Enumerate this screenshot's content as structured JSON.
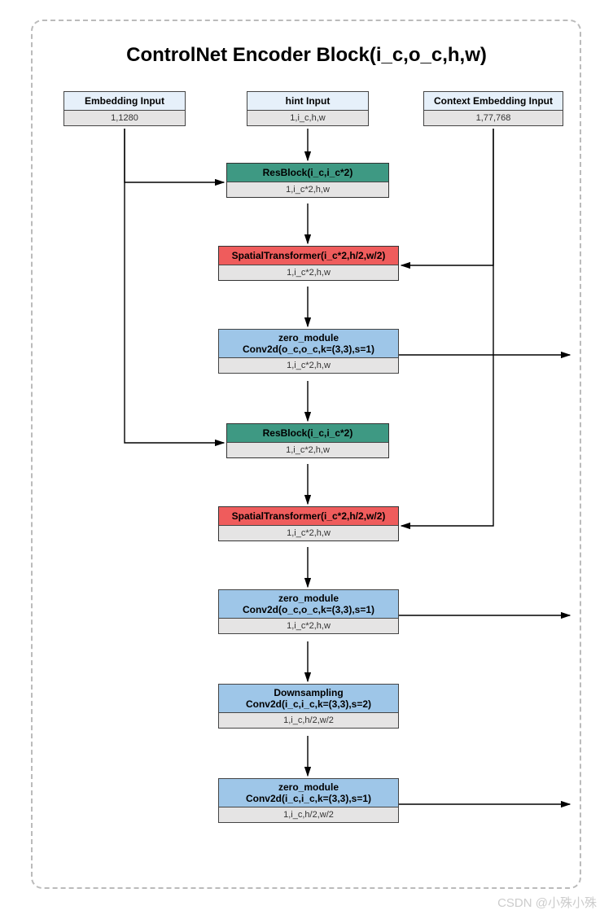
{
  "title": "ControlNet Encoder Block(i_c,o_c,h,w)",
  "inputs": {
    "embedding": {
      "label": "Embedding Input",
      "shape": "1,1280"
    },
    "hint": {
      "label": "hint Input",
      "shape": "1,i_c,h,w"
    },
    "context": {
      "label": "Context Embedding Input",
      "shape": "1,77,768"
    }
  },
  "blocks": [
    {
      "id": "res1",
      "color": "green",
      "title": [
        "ResBlock(i_c,i_c*2)"
      ],
      "shape": "1,i_c*2,h,w"
    },
    {
      "id": "st1",
      "color": "red",
      "title": [
        "SpatialTransformer(i_c*2,h/2,w/2)"
      ],
      "shape": "1,i_c*2,h,w"
    },
    {
      "id": "zero1",
      "color": "blue",
      "title": [
        "zero_module",
        "Conv2d(o_c,o_c,k=(3,3),s=1)"
      ],
      "shape": "1,i_c*2,h,w"
    },
    {
      "id": "res2",
      "color": "green",
      "title": [
        "ResBlock(i_c,i_c*2)"
      ],
      "shape": "1,i_c*2,h,w"
    },
    {
      "id": "st2",
      "color": "red",
      "title": [
        "SpatialTransformer(i_c*2,h/2,w/2)"
      ],
      "shape": "1,i_c*2,h,w"
    },
    {
      "id": "zero2",
      "color": "blue",
      "title": [
        "zero_module",
        "Conv2d(o_c,o_c,k=(3,3),s=1)"
      ],
      "shape": "1,i_c*2,h,w"
    },
    {
      "id": "down",
      "color": "blue",
      "title": [
        "Downsampling",
        "Conv2d(i_c,i_c,k=(3,3),s=2)"
      ],
      "shape": "1,i_c,h/2,w/2"
    },
    {
      "id": "zero3",
      "color": "blue",
      "title": [
        "zero_module",
        "Conv2d(i_c,i_c,k=(3,3),s=1)"
      ],
      "shape": "1,i_c,h/2,w/2"
    }
  ],
  "watermark": "CSDN @小殊小殊"
}
